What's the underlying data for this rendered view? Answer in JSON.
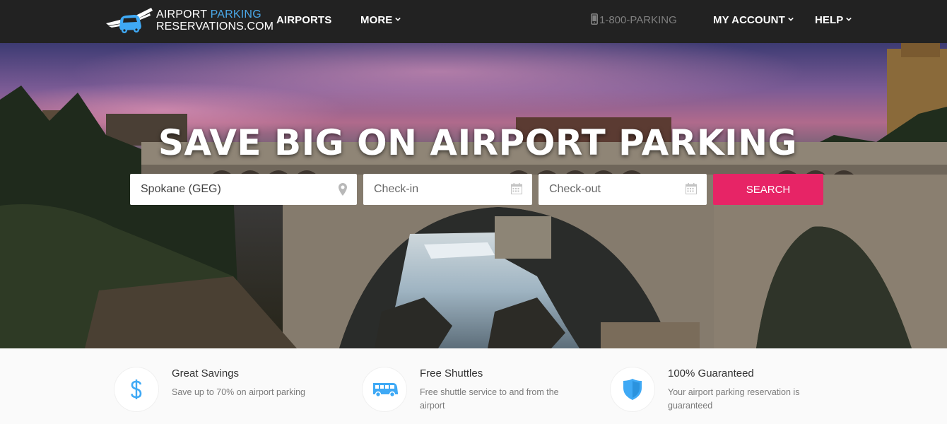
{
  "header": {
    "logo": {
      "line1_part1": "AIRPORT",
      "line1_part2": "PARKING",
      "line2": "RESERVATIONS.COM"
    },
    "nav": {
      "airports": "AIRPORTS",
      "more": "MORE",
      "phone": "1-800-PARKING",
      "account": "MY ACCOUNT",
      "help": "HELP"
    },
    "icons": {
      "logo": "car-with-wings-icon",
      "phone": "mobile-phone-icon",
      "dropdown": "chevron-down-icon"
    }
  },
  "hero": {
    "title": "SAVE BIG ON AIRPORT PARKING",
    "search": {
      "airport_value": "Spokane (GEG)",
      "checkin_placeholder": "Check-in",
      "checkout_placeholder": "Check-out",
      "button_label": "SEARCH",
      "icons": {
        "airport": "map-marker-icon",
        "checkin": "calendar-icon",
        "checkout": "calendar-icon"
      }
    }
  },
  "features": [
    {
      "title": "Great Savings",
      "desc": "Save up to 70% on airport parking",
      "icon": "dollar-icon"
    },
    {
      "title": "Free Shuttles",
      "desc": "Free shuttle service to and from the airport",
      "icon": "shuttle-bus-icon"
    },
    {
      "title": "100% Guaranteed",
      "desc": "Your airport parking reservation is guaranteed",
      "icon": "shield-icon"
    }
  ],
  "colors": {
    "header_bg": "#222222",
    "accent_blue": "#4aa8e8",
    "search_button": "#e72466",
    "feature_icon": "#3fa9f5"
  }
}
